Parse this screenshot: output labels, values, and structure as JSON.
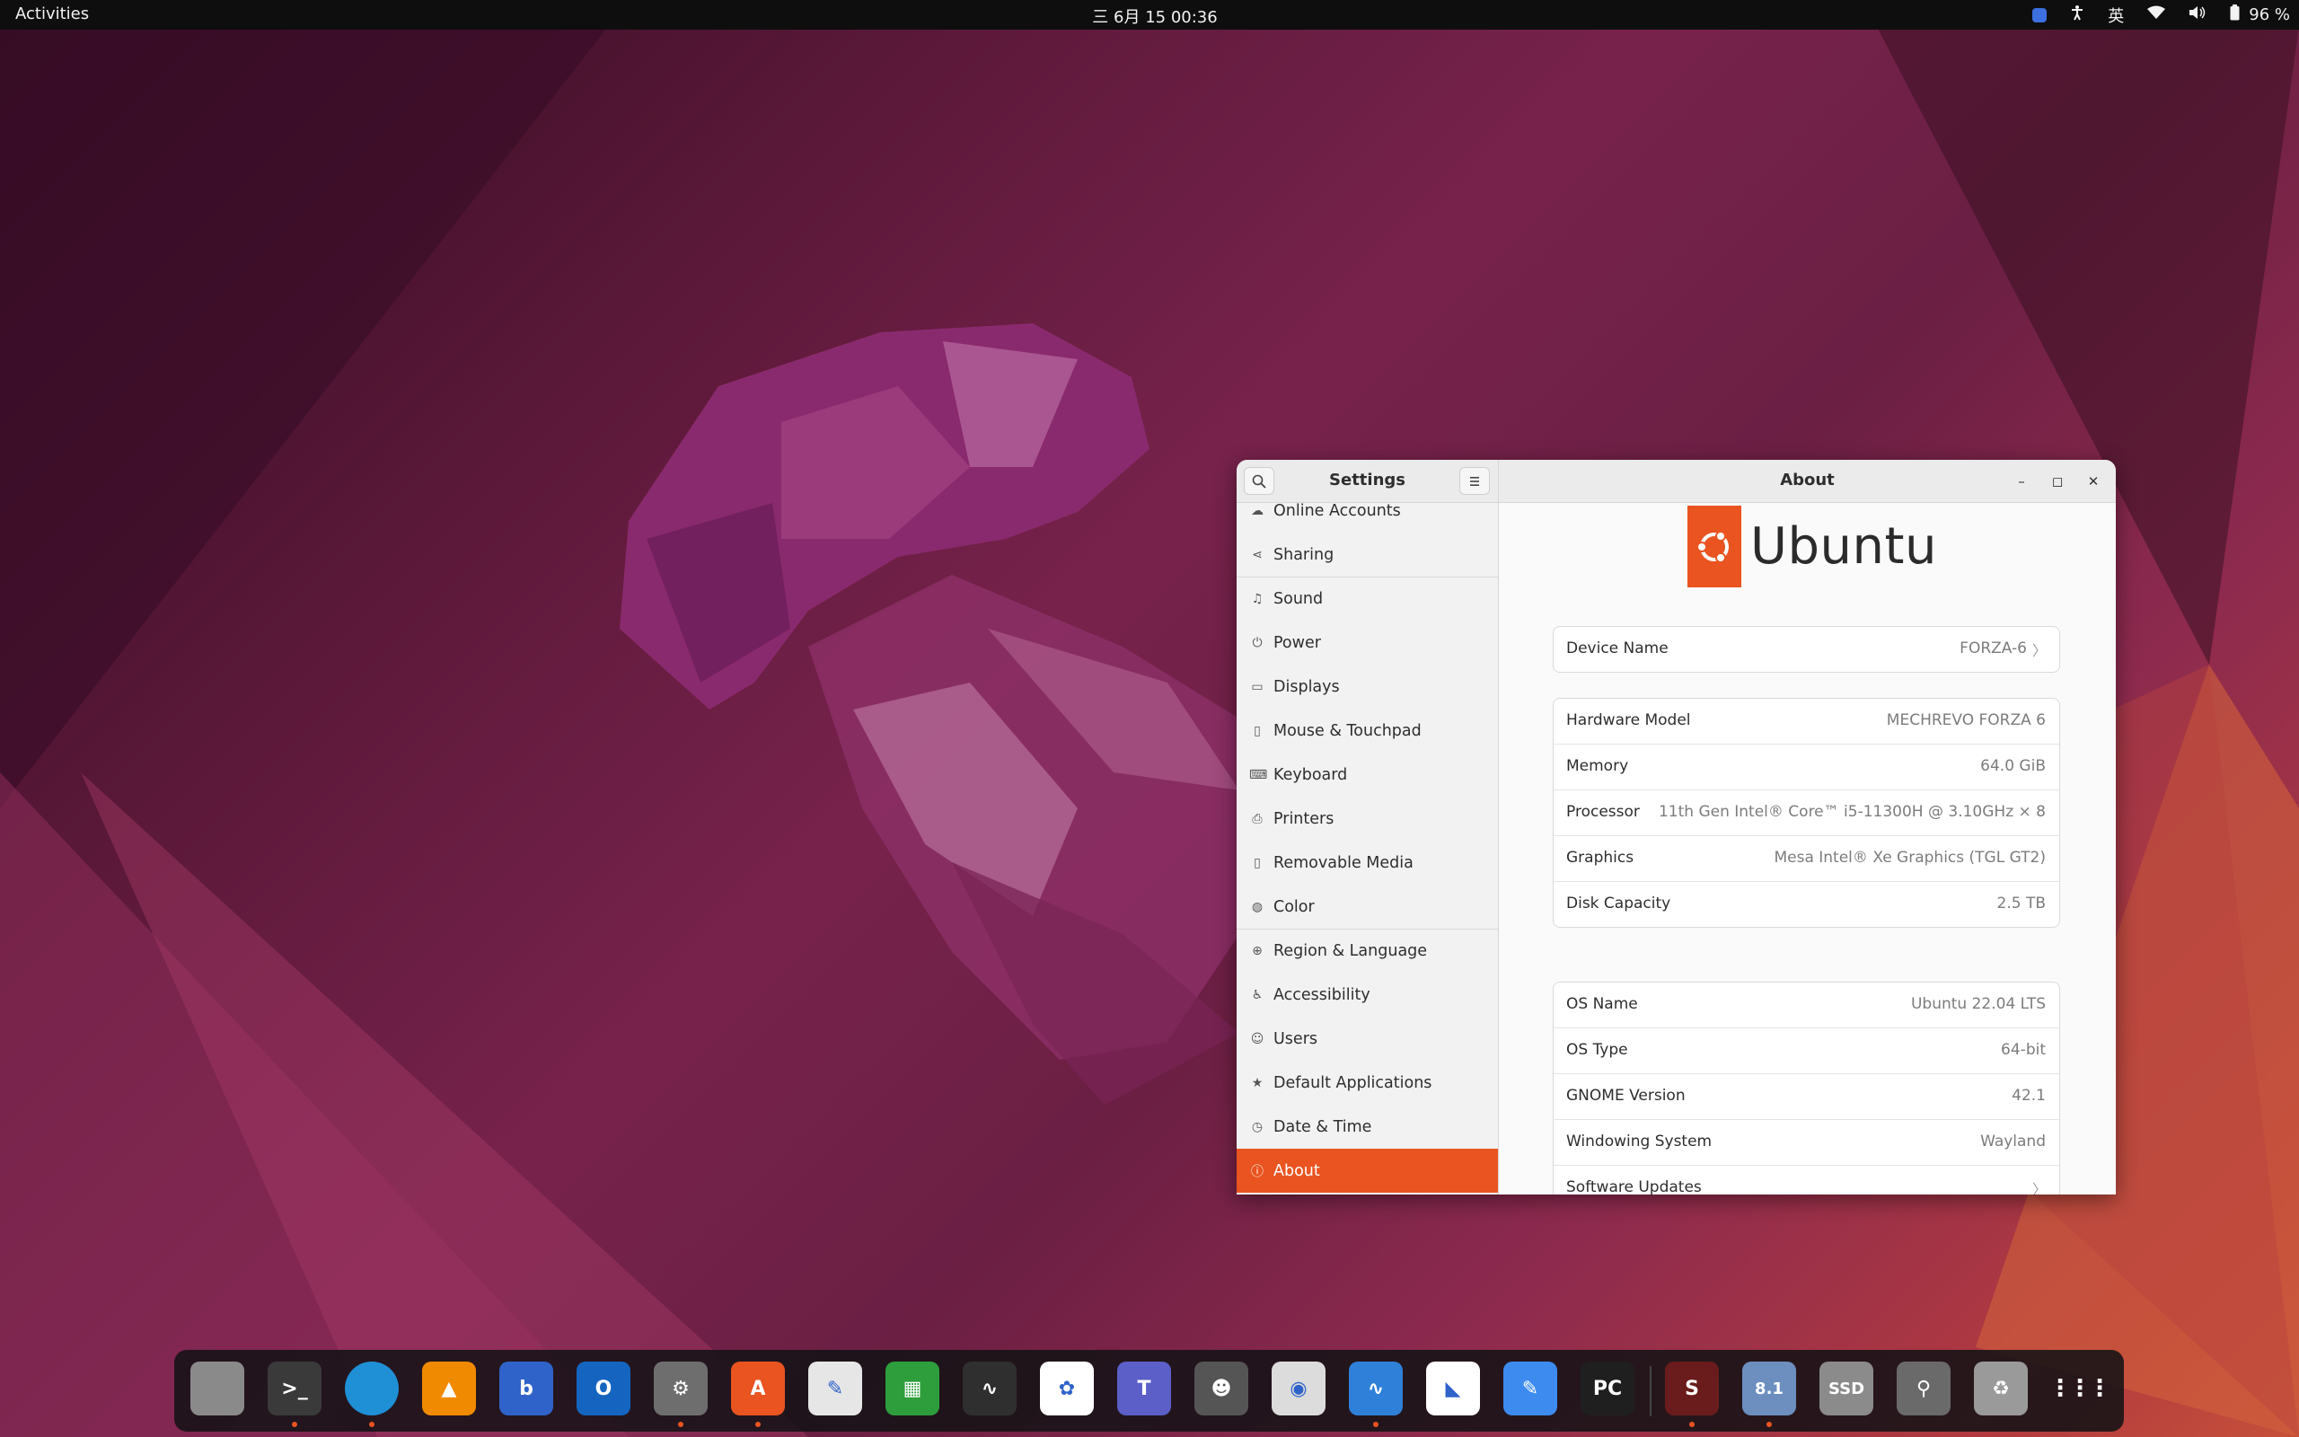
{
  "topbar": {
    "activities": "Activities",
    "clock": "三 6月 15  00:36",
    "input_method": "英",
    "battery": "96 %",
    "icons": [
      "bluetooth-app-icon",
      "accessibility-icon",
      "wifi-icon",
      "volume-icon",
      "battery-icon"
    ]
  },
  "window": {
    "sidebar_title": "Settings",
    "main_title": "About",
    "nav": [
      {
        "label": "Online Accounts",
        "icon": "cloud-icon"
      },
      {
        "label": "Sharing",
        "icon": "share-icon"
      },
      {
        "label": "Sound",
        "icon": "music-note-icon"
      },
      {
        "label": "Power",
        "icon": "power-icon"
      },
      {
        "label": "Displays",
        "icon": "display-icon"
      },
      {
        "label": "Mouse & Touchpad",
        "icon": "mouse-icon"
      },
      {
        "label": "Keyboard",
        "icon": "keyboard-icon"
      },
      {
        "label": "Printers",
        "icon": "printer-icon"
      },
      {
        "label": "Removable Media",
        "icon": "media-icon"
      },
      {
        "label": "Color",
        "icon": "color-icon"
      },
      {
        "label": "Region & Language",
        "icon": "globe-icon"
      },
      {
        "label": "Accessibility",
        "icon": "accessibility-icon"
      },
      {
        "label": "Users",
        "icon": "user-icon"
      },
      {
        "label": "Default Applications",
        "icon": "star-icon"
      },
      {
        "label": "Date & Time",
        "icon": "clock-icon"
      },
      {
        "label": "About",
        "icon": "info-icon",
        "active": true
      }
    ],
    "logo_text": "Ubuntu",
    "device": {
      "label": "Device Name",
      "value": "FORZA-6"
    },
    "hardware": [
      {
        "label": "Hardware Model",
        "value": "MECHREVO FORZA 6"
      },
      {
        "label": "Memory",
        "value": "64.0 GiB"
      },
      {
        "label": "Processor",
        "value": "11th Gen Intel® Core™ i5-11300H @ 3.10GHz × 8"
      },
      {
        "label": "Graphics",
        "value": "Mesa Intel® Xe Graphics (TGL GT2)"
      },
      {
        "label": "Disk Capacity",
        "value": "2.5 TB"
      }
    ],
    "os": [
      {
        "label": "OS Name",
        "value": "Ubuntu 22.04 LTS"
      },
      {
        "label": "OS Type",
        "value": "64-bit"
      },
      {
        "label": "GNOME Version",
        "value": "42.1"
      },
      {
        "label": "Windowing System",
        "value": "Wayland"
      },
      {
        "label": "Software Updates",
        "value": ""
      }
    ]
  },
  "dock": {
    "apps": [
      {
        "name": "files-icon",
        "glyph": "",
        "color": "#8a8a8a",
        "running": false
      },
      {
        "name": "terminal-icon",
        "glyph": ">_",
        "color": "#3a3a3a",
        "running": true
      },
      {
        "name": "edge-browser-icon",
        "glyph": "",
        "color": "#1f8fd6",
        "running": true
      },
      {
        "name": "vlc-icon",
        "glyph": "▲",
        "color": "#f08a00",
        "running": false
      },
      {
        "name": "mail-client-icon",
        "glyph": "b",
        "color": "#2f63c9",
        "running": false
      },
      {
        "name": "outlook-icon",
        "glyph": "O",
        "color": "#1565c0",
        "running": false
      },
      {
        "name": "settings-app-icon",
        "glyph": "⚙",
        "color": "#6e6e6e",
        "running": true
      },
      {
        "name": "app-center-icon",
        "glyph": "A",
        "color": "#e95420",
        "running": true
      },
      {
        "name": "text-editor-icon",
        "glyph": "✎",
        "color": "#e6e6e6",
        "running": false
      },
      {
        "name": "spreadsheet-icon",
        "glyph": "▦",
        "color": "#2e9e3c",
        "running": false
      },
      {
        "name": "system-monitor-icon",
        "glyph": "∿",
        "color": "#2f2f2f",
        "running": false
      },
      {
        "name": "cloud-drive-icon",
        "glyph": "✿",
        "color": "#ffffff",
        "running": false
      },
      {
        "name": "teams-icon",
        "glyph": "T",
        "color": "#5b5fc7",
        "running": false
      },
      {
        "name": "gimp-icon",
        "glyph": "☻",
        "color": "#555555",
        "running": false
      },
      {
        "name": "camera-icon",
        "glyph": "◉",
        "color": "#dcdcdc",
        "running": false
      },
      {
        "name": "monitor-app-icon",
        "glyph": "∿",
        "color": "#2f80d8",
        "running": true
      },
      {
        "name": "todesk-icon",
        "glyph": "◣",
        "color": "#ffffff",
        "running": false
      },
      {
        "name": "notes-app-icon",
        "glyph": "✎",
        "color": "#3d8bef",
        "running": false
      },
      {
        "name": "pycharm-icon",
        "glyph": "PC",
        "color": "#1f1f1f",
        "running": false
      },
      {
        "name": "wps-app-icon",
        "glyph": "S",
        "color": "#6a1c1c",
        "running": true
      },
      {
        "name": "bios-tool-icon",
        "glyph": "8.1",
        "color": "#6c8fbf",
        "running": true
      },
      {
        "name": "ssd-drive-icon",
        "glyph": "SSD",
        "color": "#8b8b8b",
        "running": false
      },
      {
        "name": "usb-drive-icon",
        "glyph": "⚲",
        "color": "#6a6a6a",
        "running": false
      },
      {
        "name": "trash-icon",
        "glyph": "♻",
        "color": "#9a9a9a",
        "running": false
      },
      {
        "name": "show-apps-icon",
        "glyph": "⋮⋮⋮",
        "color": "transparent",
        "running": false
      }
    ]
  }
}
